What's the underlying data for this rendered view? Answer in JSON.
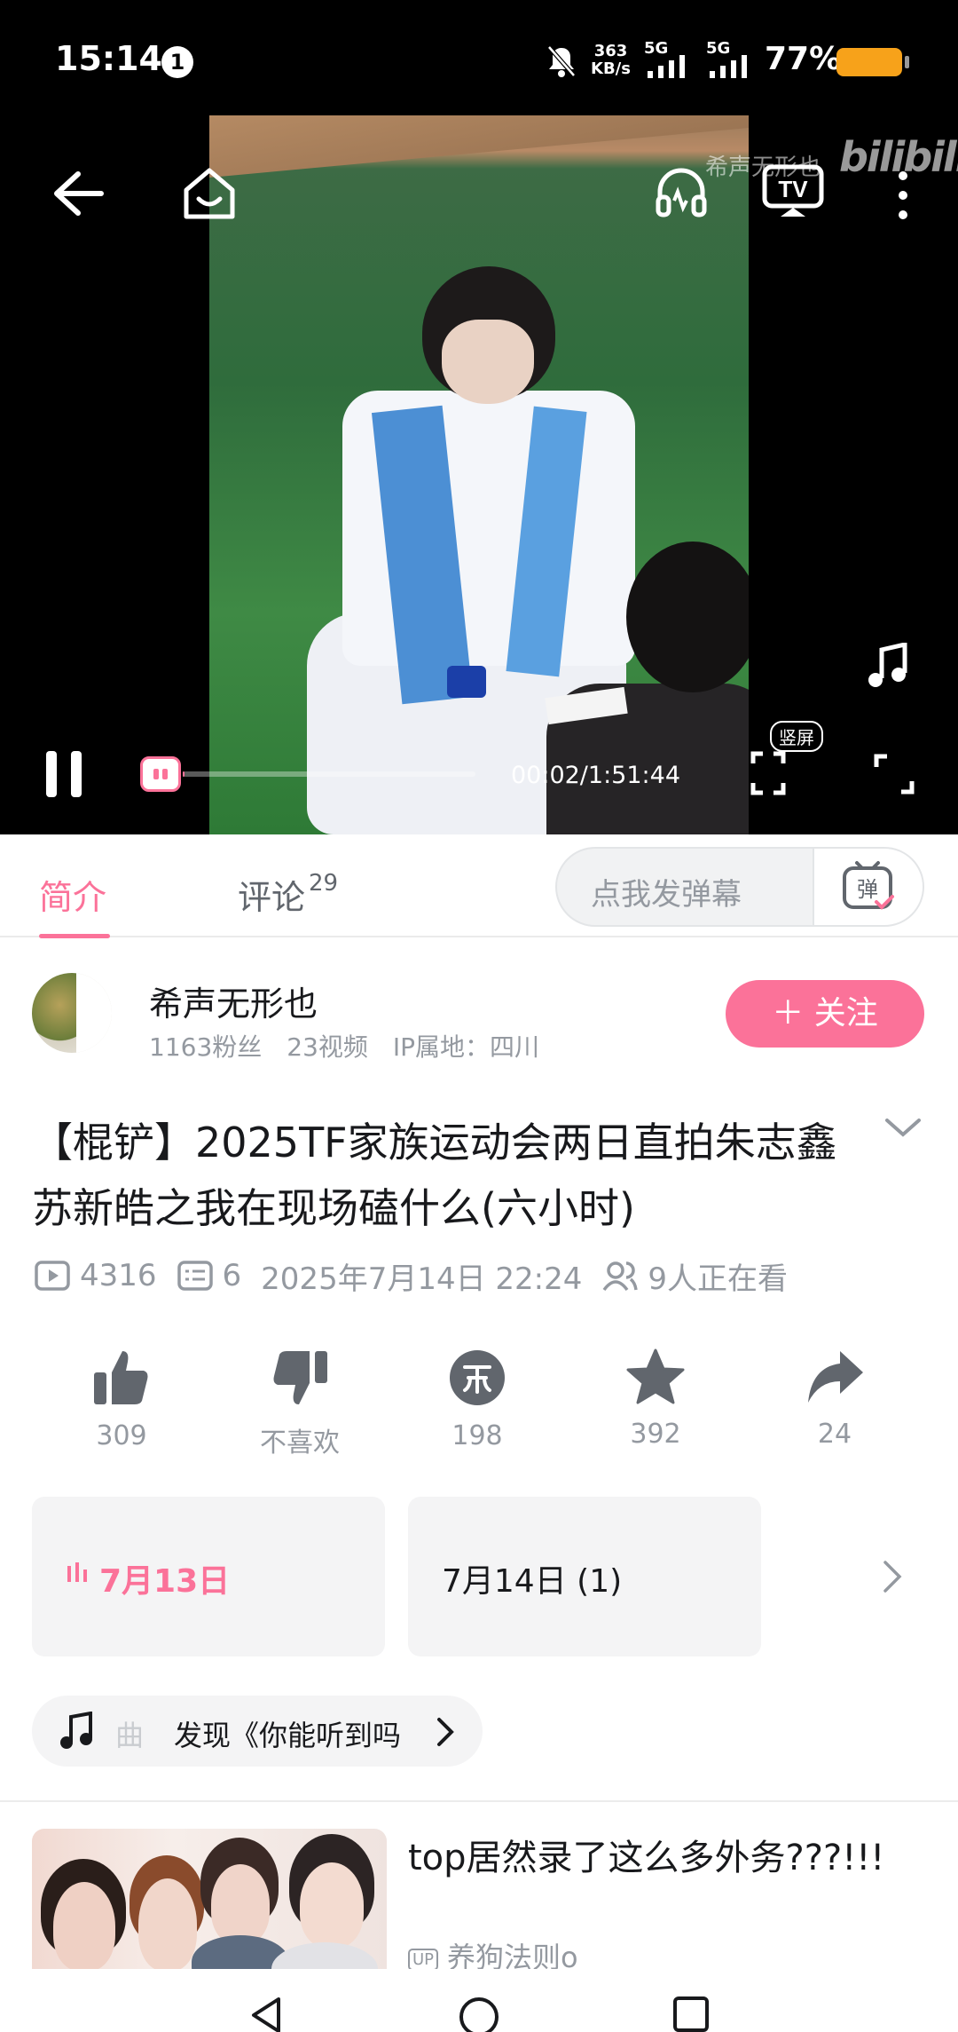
{
  "status_bar": {
    "time": "15:14",
    "notification_count": "1",
    "net_speed_value": "363",
    "net_speed_unit": "KB/s",
    "network1": "5G",
    "network2": "5G",
    "battery": "77%",
    "battery_level": 0.77,
    "battery_color": "#f7a21a"
  },
  "player": {
    "watermark": "希声无形也",
    "logo": "bilibili",
    "time_display": "00:02/1:51:44",
    "progress_fraction": 0.0003,
    "vertical_label": "竖屏",
    "icons": [
      "back-icon",
      "home-icon",
      "headphones-icon",
      "tv-cast-icon",
      "more-icon",
      "music-note-icon",
      "pause-icon",
      "danmaku-toggle-icon",
      "vertical-screen-icon",
      "fullscreen-icon"
    ]
  },
  "tabs": {
    "intro": "简介",
    "comments": "评论",
    "comments_count": "29",
    "danmaku_placeholder": "点我发弹幕",
    "danmaku_button": "弹"
  },
  "uploader": {
    "name": "希声无形也",
    "meta": "1163粉丝　23视频　IP属地：四川",
    "follow": "＋ 关注"
  },
  "video": {
    "title": "【棍铲】2025TF家族运动会两日直拍朱志鑫苏新皓之我在现场磕什么(六小时)",
    "views": "4316",
    "danmaku_count": "6",
    "date": "2025年7月14日 22:24",
    "watching": "9人正在看"
  },
  "actions": [
    {
      "icon": "thumb-up-icon",
      "label": "309"
    },
    {
      "icon": "thumb-down-icon",
      "label": "不喜欢"
    },
    {
      "icon": "coin-icon",
      "label": "198"
    },
    {
      "icon": "star-icon",
      "label": "392"
    },
    {
      "icon": "share-icon",
      "label": "24"
    }
  ],
  "episodes": [
    {
      "label": "7月13日",
      "active": true
    },
    {
      "label": "7月14日 (1)",
      "active": false
    }
  ],
  "music": {
    "category": "曲",
    "text": "发现《你能听到吗"
  },
  "recommendation": {
    "title": "top居然录了这么多外务???!!!",
    "uploader": "养狗法则o",
    "uploader_badge": "UP"
  },
  "colors": {
    "accent": "#fb7299",
    "text_primary": "#18191c",
    "text_secondary": "#9499a0"
  }
}
